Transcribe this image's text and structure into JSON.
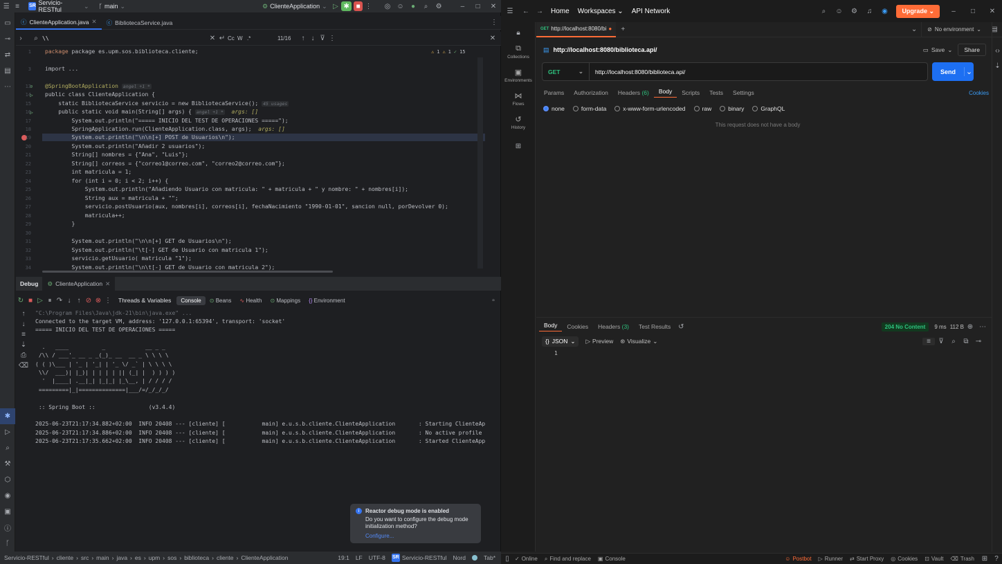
{
  "ij": {
    "title": {
      "project_badge": "SR",
      "project": "Servicio-RESTful",
      "branch": "main",
      "run_config": "ClienteApplication"
    },
    "tabs": [
      {
        "label": "ClienteApplication.java"
      },
      {
        "label": "BibliotecaService.java"
      }
    ],
    "search": {
      "value": "\\\\",
      "match_count": "11/16",
      "case": "Cc",
      "word": "W",
      "regex": ".*"
    },
    "inspections": {
      "warn": "1",
      "weak": "1",
      "ok": "15"
    },
    "code": [
      {
        "n": "1",
        "t": "package es.upm.sos.biblioteca.cliente;"
      },
      {
        "n": "3",
        "t": "import ..."
      },
      {
        "n": "13",
        "t": "@SpringBootApplication",
        "hint": "angel +1 *"
      },
      {
        "n": "14",
        "t": "public class ClienteApplication {"
      },
      {
        "n": "15",
        "t": "    static BibliotecaService servicio = new BibliotecaService();",
        "hint": "45 usages"
      },
      {
        "n": "16",
        "t": "    public static void main(String[] args) {",
        "hint": "angel +1 *",
        "extra": "args: []"
      },
      {
        "n": "17",
        "t": "        System.out.println(\"===== INICIO DEL TEST DE OPERACIONES =====\");"
      },
      {
        "n": "18",
        "t": "        SpringApplication.run(ClienteApplication.class, args);",
        "extra": "args: []"
      },
      {
        "n": "19",
        "t": "        System.out.println(\"\\n\\n[+] POST de Usuarios\\n\");"
      },
      {
        "n": "20",
        "t": "        System.out.println(\"Añadir 2 usuarios\");"
      },
      {
        "n": "21",
        "t": "        String[] nombres = {\"Ana\", \"Luis\"};"
      },
      {
        "n": "22",
        "t": "        String[] correos = {\"correo1@correo.com\", \"correo2@correo.com\"};"
      },
      {
        "n": "23",
        "t": "        int matricula = 1;"
      },
      {
        "n": "24",
        "t": "        for (int i = 0; i < 2; i++) {"
      },
      {
        "n": "25",
        "t": "            System.out.println(\"Añadiendo Usuario con matricula: \" + matricula + \" y nombre: \" + nombres[i]);"
      },
      {
        "n": "26",
        "t": "            String aux = matricula + \"\";"
      },
      {
        "n": "27",
        "t": "            servicio.postUsuario(aux, nombres[i], correos[i], fechaNacimiento \"1990-01-01\", sancion null, porDevolver 0);"
      },
      {
        "n": "28",
        "t": "            matricula++;"
      },
      {
        "n": "29",
        "t": "        }"
      },
      {
        "n": "30",
        "t": ""
      },
      {
        "n": "31",
        "t": "        System.out.println(\"\\n\\n[+] GET de Usuarios\\n\");"
      },
      {
        "n": "32",
        "t": "        System.out.println(\"\\t[-] GET de Usuario con matricula 1\");"
      },
      {
        "n": "33",
        "t": "        servicio.getUsuario( matricula \"1\");"
      },
      {
        "n": "34",
        "t": "        System.out.println(\"\\n\\t[-] GET de Usuario con matricula 2\");"
      }
    ],
    "debug": {
      "title": "Debug",
      "session": "ClienteApplication",
      "tabs": [
        {
          "label": "Threads & Variables"
        },
        {
          "label": "Console"
        },
        {
          "label": "Beans"
        },
        {
          "label": "Health"
        },
        {
          "label": "Mappings"
        },
        {
          "label": "Environment"
        }
      ]
    },
    "console": [
      "\"C:\\Program Files\\Java\\jdk-21\\bin\\java.exe\" ...",
      "Connected to the target VM, address: '127.0.0.1:65394', transport: 'socket'",
      "===== INICIO DEL TEST DE OPERACIONES =====",
      "",
      "  .   ____          _            __ _ _",
      " /\\\\ / ___'_ __ _ _(_)_ __  __ _ \\ \\ \\ \\",
      "( ( )\\___ | '_ | '_| | '_ \\/ _` | \\ \\ \\ \\",
      " \\\\/  ___)| |_)| | | | | || (_| |  ) ) ) )",
      "  '  |____| .__|_| |_|_| |_\\__, | / / / /",
      " =========|_|==============|___/=/_/_/_/",
      "",
      " :: Spring Boot ::                (v3.4.4)",
      "",
      "2025-06-23T21:17:34.882+02:00  INFO 20408 --- [cliente] [           main] e.u.s.b.cliente.ClienteApplication       : Starting ClienteApplication",
      "2025-06-23T21:17:34.886+02:00  INFO 20408 --- [cliente] [           main] e.u.s.b.cliente.ClienteApplication       : No active profile set, fall",
      "2025-06-23T21:17:35.662+02:00  INFO 20408 --- [cliente] [           main] e.u.s.b.cliente.ClienteApplication       : Started ClienteApplication"
    ],
    "notification": {
      "title": "Reactor debug mode is enabled",
      "body": "Do you want to configure the debug mode initialization method?",
      "action": "Configure..."
    },
    "breadcrumb": [
      "Servicio-RESTful",
      "cliente",
      "src",
      "main",
      "java",
      "es",
      "upm",
      "sos",
      "biblioteca",
      "cliente",
      "ClienteApplication"
    ],
    "status": {
      "position": "19:1",
      "line_sep": "LF",
      "encoding": "UTF-8",
      "project_badge": "SR",
      "project": "Servicio-RESTful",
      "theme": "Nord",
      "indent": "Tab*"
    }
  },
  "pm": {
    "nav": {
      "home": "Home",
      "workspaces": "Workspaces",
      "api_network": "API Network",
      "upgrade": "Upgrade"
    },
    "sidebar": [
      {
        "label": "Collections"
      },
      {
        "label": "Environments"
      },
      {
        "label": "Flows"
      },
      {
        "label": "History"
      }
    ],
    "tab": {
      "method": "GET",
      "label": "http://localhost:8080/bi"
    },
    "env": "No environment",
    "request": {
      "title": "http://localhost:8080/biblioteca.api/",
      "save": "Save",
      "share": "Share",
      "method": "GET",
      "url": "http://localhost:8080/biblioteca.api/",
      "send": "Send"
    },
    "req_tabs": [
      {
        "label": "Params"
      },
      {
        "label": "Authorization"
      },
      {
        "label": "Headers",
        "count": "(6)"
      },
      {
        "label": "Body"
      },
      {
        "label": "Scripts"
      },
      {
        "label": "Tests"
      },
      {
        "label": "Settings"
      }
    ],
    "cookies": "Cookies",
    "body_types": [
      {
        "label": "none"
      },
      {
        "label": "form-data"
      },
      {
        "label": "x-www-form-urlencoded"
      },
      {
        "label": "raw"
      },
      {
        "label": "binary"
      },
      {
        "label": "GraphQL"
      }
    ],
    "no_body": "This request does not have a body",
    "resp_tabs": [
      {
        "label": "Body"
      },
      {
        "label": "Cookies"
      },
      {
        "label": "Headers",
        "count": "(3)"
      },
      {
        "label": "Test Results"
      }
    ],
    "response": {
      "status": "204 No Content",
      "time": "9 ms",
      "size": "112 B",
      "format": "JSON",
      "preview": "Preview",
      "visualize": "Visualize",
      "line": "1"
    },
    "status": {
      "online": "Online",
      "find": "Find and replace",
      "console": "Console",
      "postbot": "Postbot",
      "runner": "Runner",
      "proxy": "Start Proxy",
      "cookies": "Cookies",
      "vault": "Vault",
      "trash": "Trash"
    },
    "colors": {
      "accent": "#ff6c37",
      "send": "#1d6ff2",
      "ok": "#2ec27e"
    }
  }
}
